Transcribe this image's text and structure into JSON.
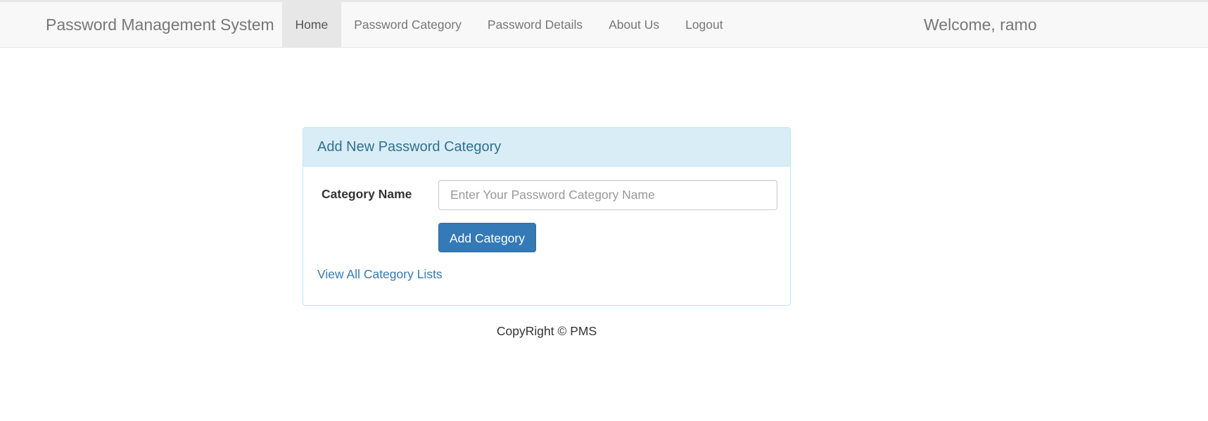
{
  "navbar": {
    "brand": "Password Management System",
    "items": [
      {
        "label": "Home",
        "active": true
      },
      {
        "label": "Password Category",
        "active": false
      },
      {
        "label": "Password Details",
        "active": false
      },
      {
        "label": "About Us",
        "active": false
      },
      {
        "label": "Logout",
        "active": false
      }
    ],
    "welcome": "Welcome, ramo"
  },
  "panel": {
    "heading": "Add New Password Category",
    "category_label": "Category Name",
    "input": {
      "value": "",
      "placeholder": "Enter Your Password Category Name"
    },
    "submit_label": "Add Category",
    "view_all_link": "View All Category Lists"
  },
  "footer": {
    "text": "CopyRight © PMS"
  },
  "colors": {
    "navbar_bg": "#f8f8f8",
    "nav_active_bg": "#e7e7e7",
    "panel_heading_bg": "#d9edf7",
    "panel_heading_text": "#31708f",
    "primary": "#337ab7",
    "link": "#337ab7"
  }
}
